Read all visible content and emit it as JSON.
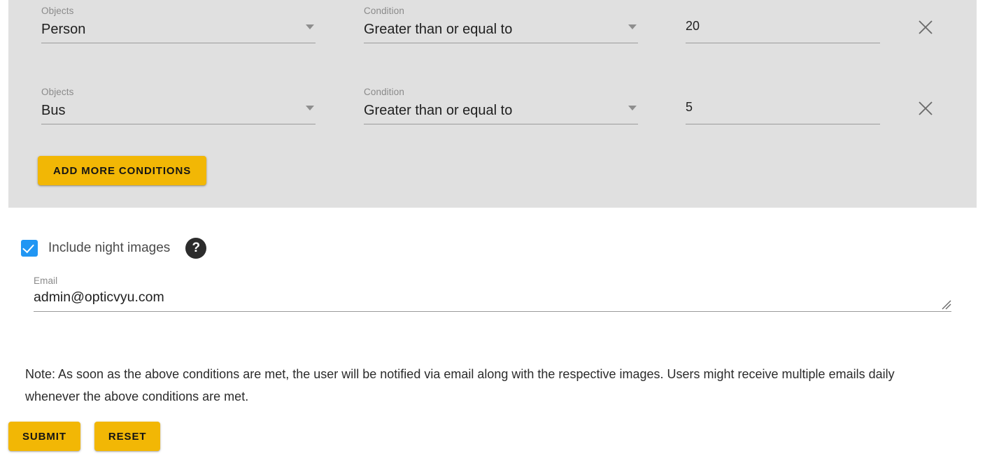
{
  "colors": {
    "panel_background": "#e0e0e0",
    "page_background": "#ffffff",
    "accent_yellow": "#f2b705",
    "checkbox_blue": "#2196f3",
    "help_icon_dark": "#2c2c2c",
    "underline_grey": "#9b9b9b",
    "label_grey": "#8a8a8a"
  },
  "conditions_panel": {
    "rows": [
      {
        "object_label": "Objects",
        "object_value": "Person",
        "condition_label": "Condition",
        "condition_value": "Greater than or equal to",
        "threshold_value": "20",
        "remove_icon": "close-icon"
      },
      {
        "object_label": "Objects",
        "object_value": "Bus",
        "condition_label": "Condition",
        "condition_value": "Greater than or equal to",
        "threshold_value": "5",
        "remove_icon": "close-icon"
      }
    ],
    "add_more_label": "ADD MORE CONDITIONS"
  },
  "night_images": {
    "label": "Include night images",
    "checked": true,
    "help_icon": "help-icon",
    "help_glyph": "?"
  },
  "email": {
    "label": "Email",
    "value": "admin@opticvyu.com",
    "resize_handle": "resize-grip-icon"
  },
  "note": {
    "text": "Note: As soon as the above conditions are met, the user will be notified via email along with the respective images. Users might receive multiple emails daily whenever the above conditions are met."
  },
  "footer": {
    "submit_label": "SUBMIT",
    "reset_label": "RESET"
  }
}
